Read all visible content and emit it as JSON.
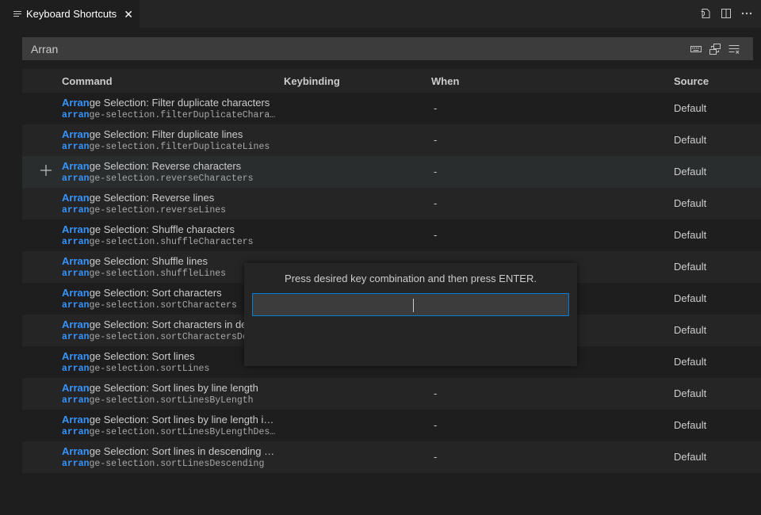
{
  "tab": {
    "title": "Keyboard Shortcuts",
    "icon": "list-lines-icon",
    "close_icon": "close-icon"
  },
  "editor_actions": [
    {
      "name": "open-json-icon"
    },
    {
      "name": "split-editor-icon"
    },
    {
      "name": "more-actions-icon"
    }
  ],
  "search": {
    "value": "Arran",
    "actions": [
      "record-keys-icon",
      "sort-by-precedence-icon",
      "clear-search-icon"
    ]
  },
  "table": {
    "columns": {
      "command": "Command",
      "keybinding": "Keybinding",
      "when": "When",
      "source": "Source"
    },
    "rows": [
      {
        "title_hl": "Arran",
        "title_rest": "ge Selection: Filter duplicate characters",
        "id_hl": "arran",
        "id_rest": "ge-selection.filterDuplicateCharact…",
        "when": "-",
        "source": "Default"
      },
      {
        "title_hl": "Arran",
        "title_rest": "ge Selection: Filter duplicate lines",
        "id_hl": "arran",
        "id_rest": "ge-selection.filterDuplicateLines",
        "when": "-",
        "source": "Default"
      },
      {
        "title_hl": "Arran",
        "title_rest": "ge Selection: Reverse characters",
        "id_hl": "arran",
        "id_rest": "ge-selection.reverseCharacters",
        "when": "-",
        "source": "Default"
      },
      {
        "title_hl": "Arran",
        "title_rest": "ge Selection: Reverse lines",
        "id_hl": "arran",
        "id_rest": "ge-selection.reverseLines",
        "when": "-",
        "source": "Default"
      },
      {
        "title_hl": "Arran",
        "title_rest": "ge Selection: Shuffle characters",
        "id_hl": "arran",
        "id_rest": "ge-selection.shuffleCharacters",
        "when": "-",
        "source": "Default"
      },
      {
        "title_hl": "Arran",
        "title_rest": "ge Selection: Shuffle lines",
        "id_hl": "arran",
        "id_rest": "ge-selection.shuffleLines",
        "when": "",
        "source": "Default"
      },
      {
        "title_hl": "Arran",
        "title_rest": "ge Selection: Sort characters",
        "id_hl": "arran",
        "id_rest": "ge-selection.sortCharacters",
        "when": "",
        "source": "Default"
      },
      {
        "title_hl": "Arran",
        "title_rest": "ge Selection: Sort characters in des",
        "id_hl": "arran",
        "id_rest": "ge-selection.sortCharactersDesc",
        "when": "",
        "source": "Default"
      },
      {
        "title_hl": "Arran",
        "title_rest": "ge Selection: Sort lines",
        "id_hl": "arran",
        "id_rest": "ge-selection.sortLines",
        "when": "",
        "source": "Default"
      },
      {
        "title_hl": "Arran",
        "title_rest": "ge Selection: Sort lines by line length",
        "id_hl": "arran",
        "id_rest": "ge-selection.sortLinesByLength",
        "when": "-",
        "source": "Default"
      },
      {
        "title_hl": "Arran",
        "title_rest": "ge Selection: Sort lines by line length in…",
        "id_hl": "arran",
        "id_rest": "ge-selection.sortLinesByLengthDesce…",
        "when": "-",
        "source": "Default"
      },
      {
        "title_hl": "Arran",
        "title_rest": "ge Selection: Sort lines in descending o…",
        "id_hl": "arran",
        "id_rest": "ge-selection.sortLinesDescending",
        "when": "-",
        "source": "Default"
      }
    ],
    "selected_row_index": 2,
    "add_icon": "plus-icon"
  },
  "modal": {
    "message": "Press desired key combination and then press ENTER.",
    "input_value": ""
  },
  "colors": {
    "highlight": "#3794ff",
    "input_border": "#007fd4",
    "background": "#1e1e1e"
  }
}
